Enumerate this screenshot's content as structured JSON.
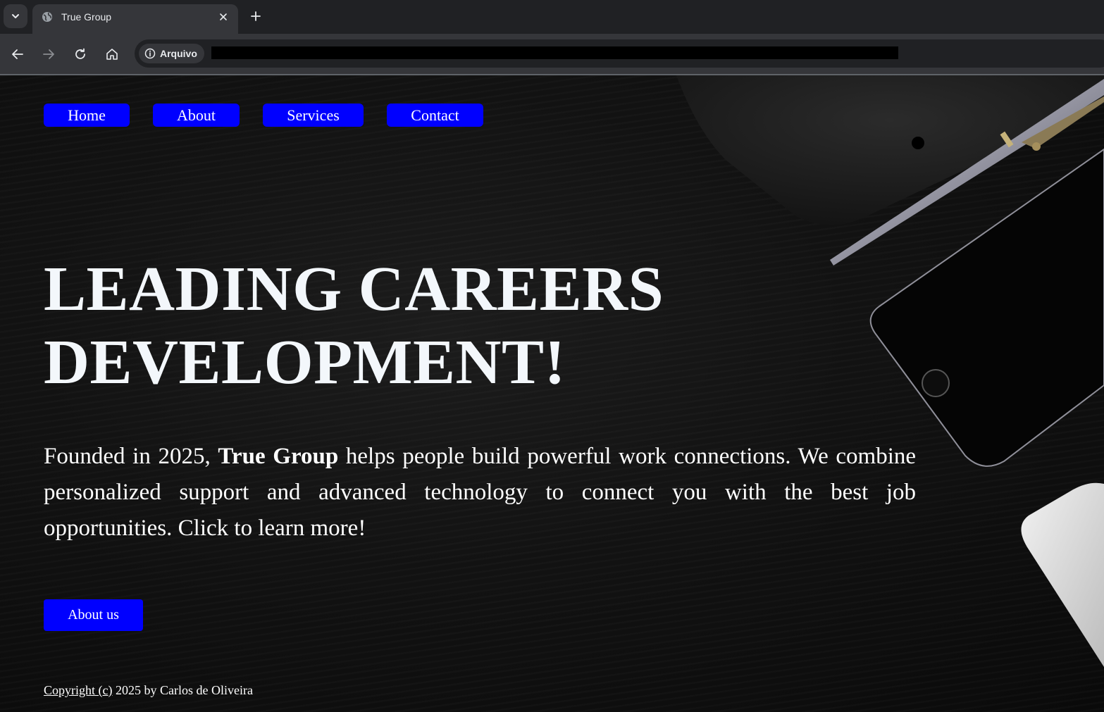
{
  "browser": {
    "tab_title": "True Group",
    "site_chip_label": "Arquivo",
    "icons": {
      "tab_search": "chevron-down-icon",
      "favicon": "globe-icon",
      "close": "close-icon",
      "new_tab": "plus-icon",
      "back": "arrow-left-icon",
      "forward": "arrow-right-icon",
      "reload": "reload-icon",
      "home": "home-icon",
      "info": "info-icon"
    }
  },
  "nav": {
    "items": [
      {
        "label": "Home"
      },
      {
        "label": "About"
      },
      {
        "label": "Services"
      },
      {
        "label": "Contact"
      }
    ]
  },
  "hero": {
    "title_line1": "LEADING CAREERS",
    "title_line2": "DEVELOPMENT!",
    "text_before": "Founded in 2025, ",
    "text_bold": "True Group",
    "text_after": " helps people build powerful work connections. We combine personalized support and advanced technology to connect you with the best job opportunities. Click to learn more!",
    "cta_label": "About us"
  },
  "footer": {
    "copyright_link": "Copyright (c)",
    "text": " 2025 by Carlos de Oliveira"
  },
  "colors": {
    "button_blue": "#0000ff",
    "chrome_dark": "#202124",
    "chrome_toolbar": "#35363a",
    "title_color": "#f3f7fb"
  }
}
